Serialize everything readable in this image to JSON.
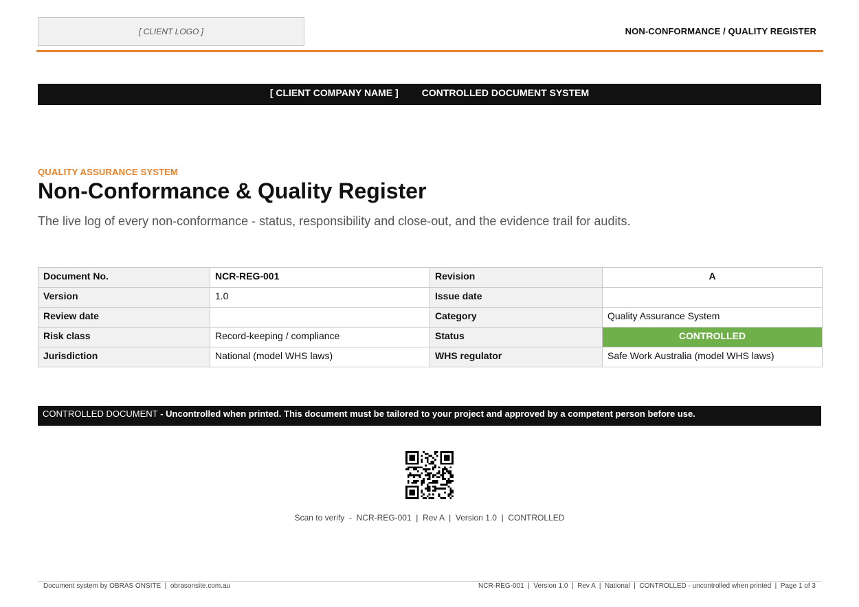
{
  "header": {
    "logo_placeholder": "[ CLIENT LOGO ]",
    "register_title": "NON-CONFORMANCE / QUALITY REGISTER"
  },
  "company_bar": {
    "company_name": "[ CLIENT COMPANY NAME ]",
    "system_label": "CONTROLLED DOCUMENT SYSTEM"
  },
  "title_block": {
    "kicker": "QUALITY ASSURANCE SYSTEM",
    "title": "Non-Conformance & Quality Register",
    "subtitle": "The live log of every non-conformance - status, responsibility and close-out, and the evidence trail for audits."
  },
  "meta_table": {
    "rows": [
      {
        "label1": "Document No.",
        "value1": "NCR-REG-001",
        "label2": "Revision",
        "value2": "A"
      },
      {
        "label1": "Version",
        "value1": "1.0",
        "label2": "Issue date",
        "value2": ""
      },
      {
        "label1": "Review date",
        "value1": "",
        "label2": "Category",
        "value2": "Quality Assurance System"
      },
      {
        "label1": "Risk class",
        "value1": "Record-keeping / compliance",
        "label2": "Status",
        "value2": "CONTROLLED"
      },
      {
        "label1": "Jurisdiction",
        "value1": "National (model WHS laws)",
        "label2": "WHS regulator",
        "value2": "Safe Work Australia (model WHS laws)"
      }
    ]
  },
  "notice": {
    "lead": "CONTROLLED DOCUMENT",
    "text": " - Uncontrolled when printed. This document must be tailored to your project and approved by a competent person before use."
  },
  "verify": {
    "caption": "Scan to verify  -  NCR-REG-001  |  Rev A  |  Version 1.0  |  CONTROLLED"
  },
  "footer": {
    "left": "Document system by OBRAS ONSITE  |  obrasonsite.com.au",
    "right": "NCR-REG-001  |  Version 1.0  |  Rev A  |  National  |  CONTROLLED - uncontrolled when printed  |  Page 1 of 3"
  },
  "colors": {
    "accent": "#e8822a",
    "status_green": "#6fb04a",
    "bar_black": "#111111"
  }
}
